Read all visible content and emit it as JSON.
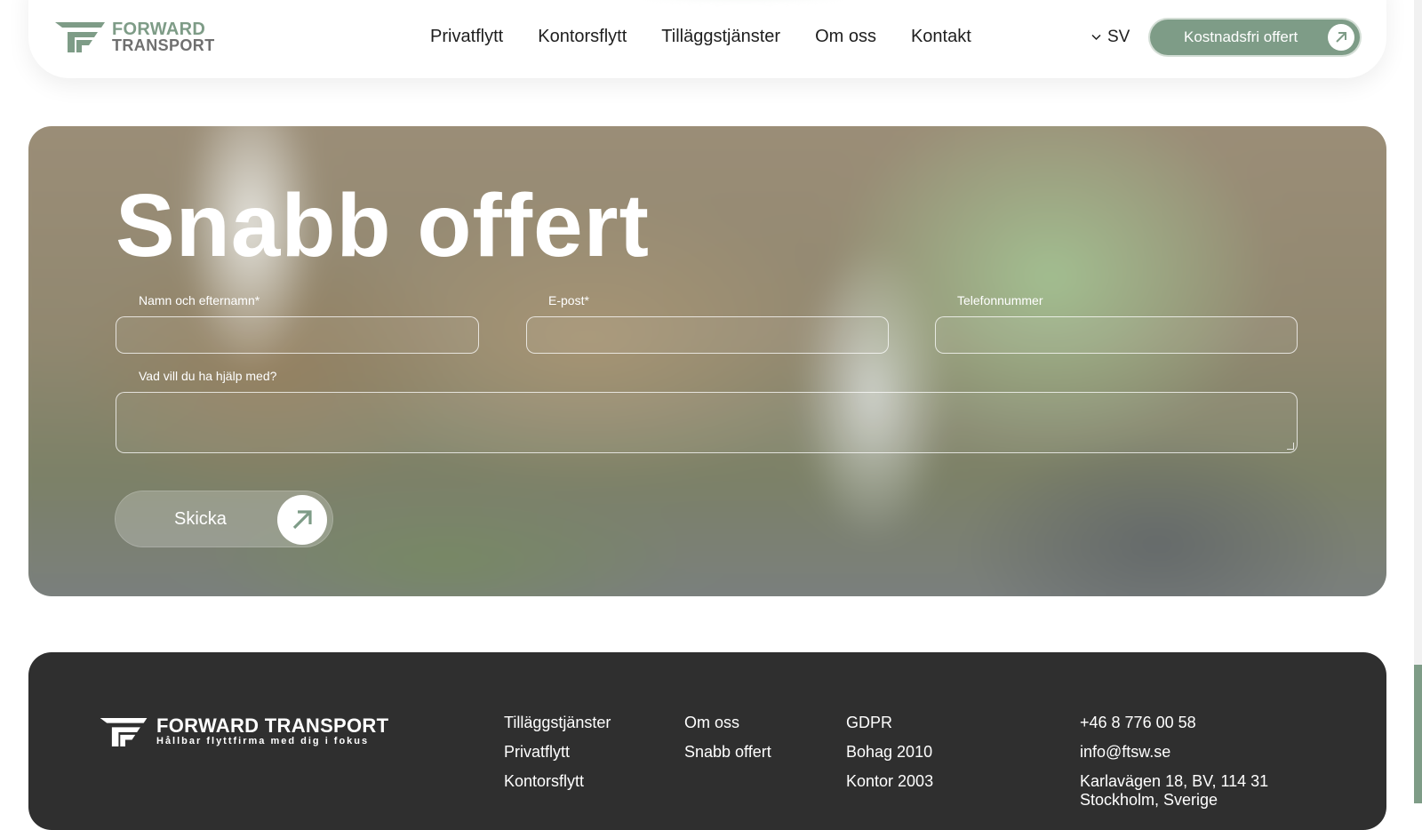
{
  "header": {
    "logo": {
      "line1": "FORWARD",
      "line2": "TRANSPORT"
    },
    "nav": [
      "Privatflytt",
      "Kontorsflytt",
      "Tilläggstjänster",
      "Om oss",
      "Kontakt"
    ],
    "language": "SV",
    "cta_label": "Kostnadsfri offert"
  },
  "form": {
    "title": "Snabb offert",
    "name_label": "Namn och efternamn*",
    "email_label": "E-post*",
    "phone_label": "Telefonnummer",
    "message_label": "Vad vill du ha hjälp med?",
    "submit_label": "Skicka"
  },
  "footer": {
    "logo_name": "FORWARD TRANSPORT",
    "logo_tagline": "Hållbar flyttfirma med dig i fokus",
    "col1": [
      "Tilläggstjänster",
      "Privatflytt",
      "Kontorsflytt"
    ],
    "col2": [
      "Om oss",
      "Snabb offert"
    ],
    "col3": [
      "GDPR",
      "Bohag 2010",
      "Kontor 2003"
    ],
    "contact": {
      "phone": "+46 8 776 00 58",
      "email": "info@ftsw.se",
      "address_line1": "Karlavägen 18, BV, 114 31",
      "address_line2": "Stockholm, Sverige"
    }
  },
  "colors": {
    "brand_green": "#7e9c87",
    "footer_bg": "#2f2f2f"
  }
}
